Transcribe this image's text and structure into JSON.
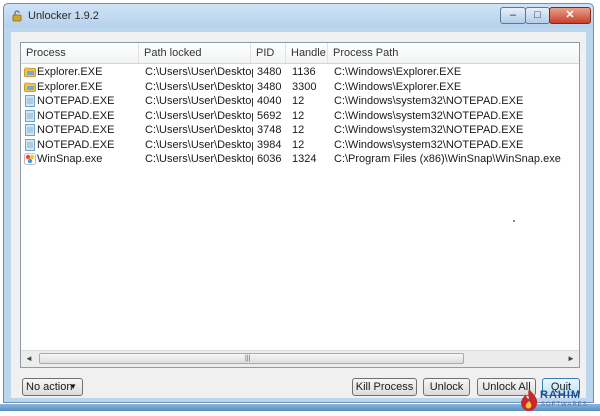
{
  "window": {
    "title": "Unlocker 1.9.2",
    "minimize_glyph": "–",
    "maximize_glyph": "□",
    "close_glyph": "✕"
  },
  "table": {
    "columns": [
      "Process",
      "Path locked",
      "PID",
      "Handle",
      "Process Path"
    ],
    "rows": [
      {
        "icon": "explorer-icon",
        "process": "Explorer.EXE",
        "path": "C:\\Users\\User\\Desktop",
        "pid": "3480",
        "handle": "1136",
        "ppath": "C:\\Windows\\Explorer.EXE"
      },
      {
        "icon": "explorer-icon",
        "process": "Explorer.EXE",
        "path": "C:\\Users\\User\\Desktop",
        "pid": "3480",
        "handle": "3300",
        "ppath": "C:\\Windows\\Explorer.EXE"
      },
      {
        "icon": "notepad-icon",
        "process": "NOTEPAD.EXE",
        "path": "C:\\Users\\User\\Desktop",
        "pid": "4040",
        "handle": "12",
        "ppath": "C:\\Windows\\system32\\NOTEPAD.EXE"
      },
      {
        "icon": "notepad-icon",
        "process": "NOTEPAD.EXE",
        "path": "C:\\Users\\User\\Desktop",
        "pid": "5692",
        "handle": "12",
        "ppath": "C:\\Windows\\system32\\NOTEPAD.EXE"
      },
      {
        "icon": "notepad-icon",
        "process": "NOTEPAD.EXE",
        "path": "C:\\Users\\User\\Desktop",
        "pid": "3748",
        "handle": "12",
        "ppath": "C:\\Windows\\system32\\NOTEPAD.EXE"
      },
      {
        "icon": "notepad-icon",
        "process": "NOTEPAD.EXE",
        "path": "C:\\Users\\User\\Desktop",
        "pid": "3984",
        "handle": "12",
        "ppath": "C:\\Windows\\system32\\NOTEPAD.EXE"
      },
      {
        "icon": "winsnap-icon",
        "process": "WinSnap.exe",
        "path": "C:\\Users\\User\\Desktop",
        "pid": "6036",
        "handle": "1324",
        "ppath": "C:\\Program Files (x86)\\WinSnap\\WinSnap.exe"
      }
    ]
  },
  "scrollbar": {
    "left_arrow": "◄",
    "right_arrow": "►",
    "grip": "|||"
  },
  "controls": {
    "action_select": "No action",
    "dropdown_glyph": "▼",
    "kill_process": "Kill Process",
    "unlock": "Unlock",
    "unlock_all": "Unlock All",
    "quit": "Quit"
  },
  "watermark": {
    "name": "RAHIM",
    "sub": "SOFTWARES"
  },
  "colors": {
    "window_frame": "#bcd6ee",
    "close_button": "#c7402a",
    "quit_border": "#3c7fb1"
  }
}
